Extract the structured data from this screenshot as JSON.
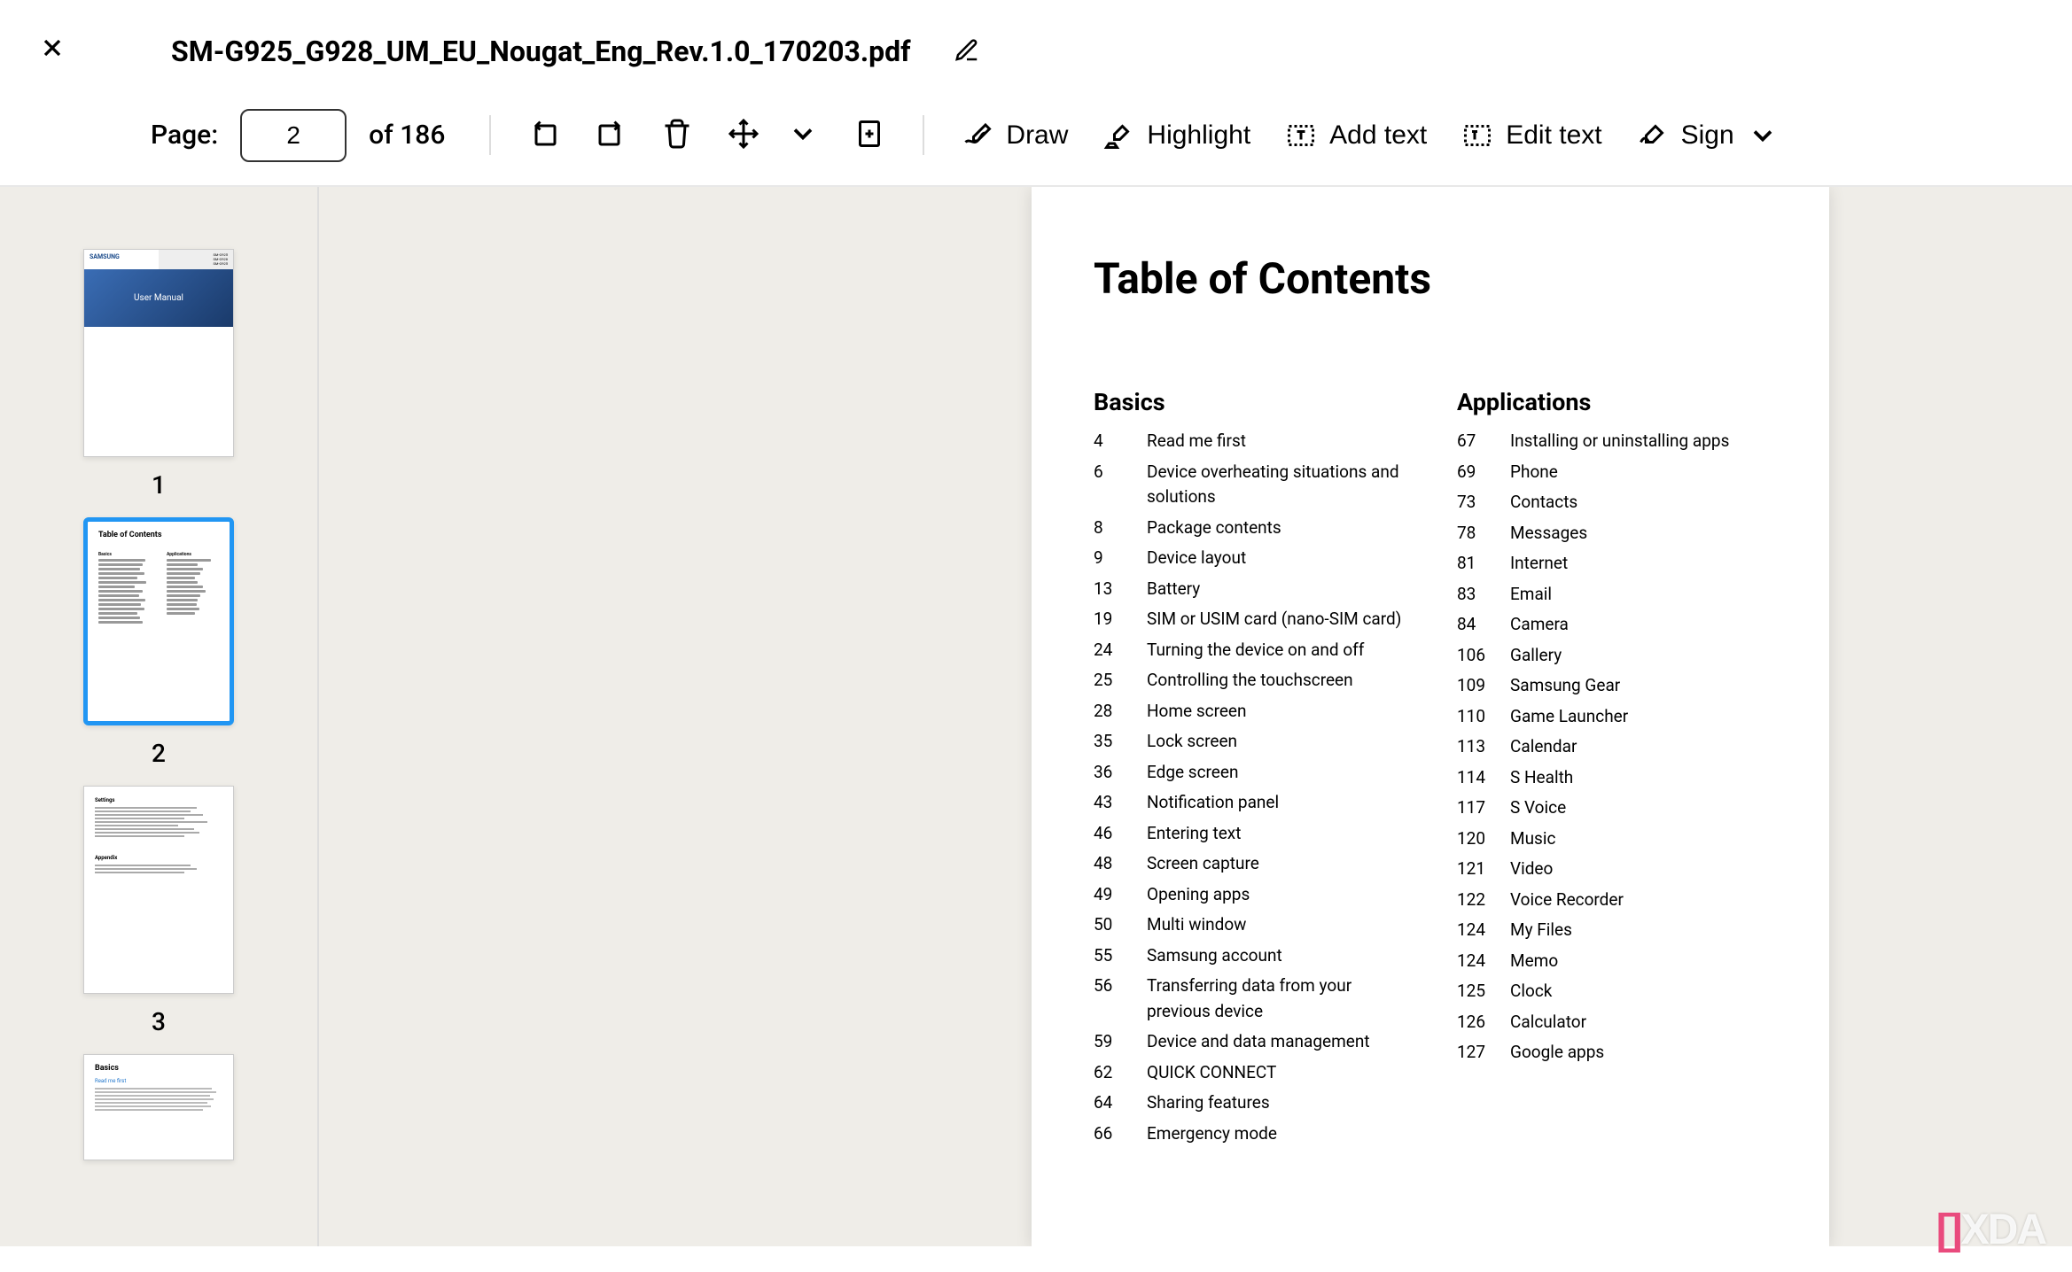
{
  "header": {
    "filename": "SM-G925_G928_UM_EU_Nougat_Eng_Rev.1.0_170203.pdf"
  },
  "toolbar": {
    "page_label": "Page:",
    "current_page": "2",
    "of": "of",
    "total_pages": "186",
    "draw": "Draw",
    "highlight": "Highlight",
    "add_text": "Add text",
    "edit_text": "Edit text",
    "sign": "Sign"
  },
  "thumbnails": {
    "t1": {
      "label": "1",
      "brand": "SAMSUNG",
      "subtitle": "User Manual"
    },
    "t2": {
      "label": "2",
      "title": "Table of Contents"
    },
    "t3": {
      "label": "3"
    },
    "t4": {
      "title": "Basics",
      "sub": "Read me first"
    }
  },
  "page": {
    "title": "Table of Contents",
    "sections": {
      "basics": {
        "title": "Basics",
        "items": [
          {
            "p": "4",
            "t": "Read me first"
          },
          {
            "p": "6",
            "t": "Device overheating situations and solutions"
          },
          {
            "p": "8",
            "t": "Package contents"
          },
          {
            "p": "9",
            "t": "Device layout"
          },
          {
            "p": "13",
            "t": "Battery"
          },
          {
            "p": "19",
            "t": "SIM or USIM card (nano-SIM card)"
          },
          {
            "p": "24",
            "t": "Turning the device on and off"
          },
          {
            "p": "25",
            "t": "Controlling the touchscreen"
          },
          {
            "p": "28",
            "t": "Home screen"
          },
          {
            "p": "35",
            "t": "Lock screen"
          },
          {
            "p": "36",
            "t": "Edge screen"
          },
          {
            "p": "43",
            "t": "Notification panel"
          },
          {
            "p": "46",
            "t": "Entering text"
          },
          {
            "p": "48",
            "t": "Screen capture"
          },
          {
            "p": "49",
            "t": "Opening apps"
          },
          {
            "p": "50",
            "t": "Multi window"
          },
          {
            "p": "55",
            "t": "Samsung account"
          },
          {
            "p": "56",
            "t": "Transferring data from your previous device"
          },
          {
            "p": "59",
            "t": "Device and data management"
          },
          {
            "p": "62",
            "t": "QUICK CONNECT"
          },
          {
            "p": "64",
            "t": "Sharing features"
          },
          {
            "p": "66",
            "t": "Emergency mode"
          }
        ]
      },
      "applications": {
        "title": "Applications",
        "items": [
          {
            "p": "67",
            "t": "Installing or uninstalling apps"
          },
          {
            "p": "69",
            "t": "Phone"
          },
          {
            "p": "73",
            "t": "Contacts"
          },
          {
            "p": "78",
            "t": "Messages"
          },
          {
            "p": "81",
            "t": "Internet"
          },
          {
            "p": "83",
            "t": "Email"
          },
          {
            "p": "84",
            "t": "Camera"
          },
          {
            "p": "106",
            "t": "Gallery"
          },
          {
            "p": "109",
            "t": "Samsung Gear"
          },
          {
            "p": "110",
            "t": "Game Launcher"
          },
          {
            "p": "113",
            "t": "Calendar"
          },
          {
            "p": "114",
            "t": "S Health"
          },
          {
            "p": "117",
            "t": "S Voice"
          },
          {
            "p": "120",
            "t": "Music"
          },
          {
            "p": "121",
            "t": "Video"
          },
          {
            "p": "122",
            "t": "Voice Recorder"
          },
          {
            "p": "124",
            "t": "My Files"
          },
          {
            "p": "124",
            "t": "Memo"
          },
          {
            "p": "125",
            "t": "Clock"
          },
          {
            "p": "126",
            "t": "Calculator"
          },
          {
            "p": "127",
            "t": "Google apps"
          }
        ]
      }
    }
  },
  "watermark": {
    "bracket": "[]",
    "text": "XDA"
  }
}
